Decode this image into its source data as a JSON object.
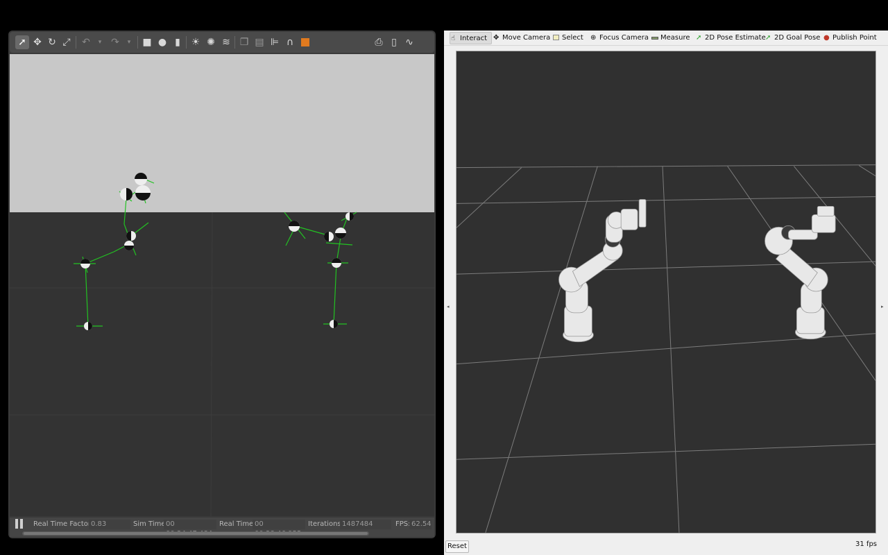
{
  "gazebo": {
    "toolbar": {
      "tools": [
        "select-arrow",
        "translate",
        "rotate",
        "scale",
        "undo",
        "undo-dropdown",
        "redo",
        "redo-dropdown",
        "box",
        "sphere",
        "cylinder",
        "point-light",
        "spot-light",
        "directional-light",
        "copy",
        "paste",
        "align",
        "magnet",
        "snap",
        "screenshot",
        "log",
        "plot"
      ]
    },
    "status": {
      "rtf_label": "Real Time Factor:",
      "rtf_value": "0.83",
      "sim_label": "Sim Time:",
      "sim_value": "00 00:24:47.484",
      "real_label": "Real Time:",
      "real_value": "00 00:28:46.955",
      "iter_label": "Iterations:",
      "iter_value": "1487484",
      "fps_label": "FPS:",
      "fps_value": "62.54"
    }
  },
  "rviz": {
    "toolbar": {
      "interact": "Interact",
      "move_camera": "Move Camera",
      "select": "Select",
      "focus_camera": "Focus Camera",
      "measure": "Measure",
      "pose_estimate": "2D Pose Estimate",
      "goal_pose": "2D Goal Pose",
      "publish_point": "Publish Point"
    },
    "reset_label": "Reset",
    "fps": "31 fps",
    "colors": {
      "grid": "#8a8a8a",
      "background": "#303030",
      "robot": "#e8e8e8"
    }
  }
}
